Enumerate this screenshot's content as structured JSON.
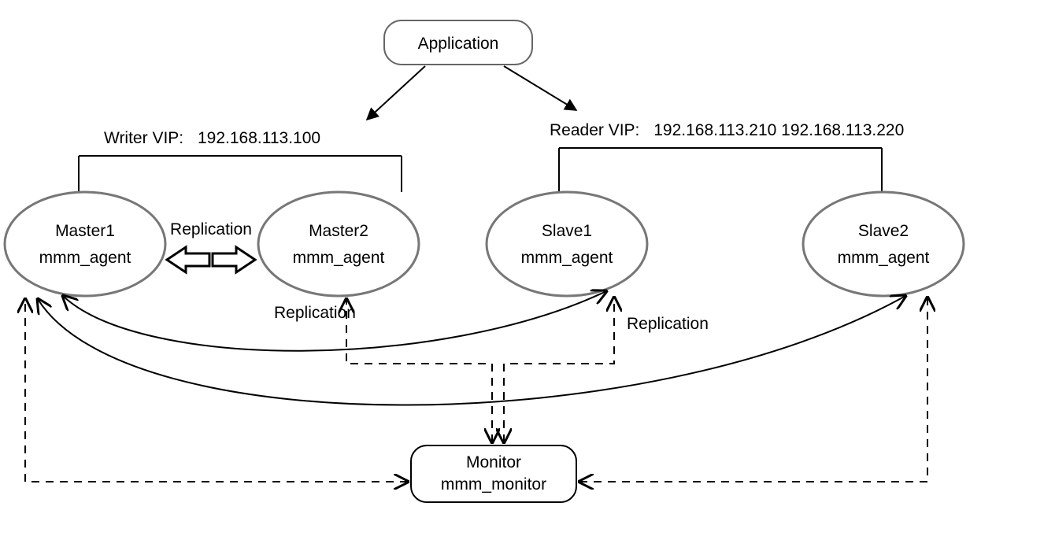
{
  "nodes": {
    "application": {
      "label": "Application"
    },
    "master1": {
      "title": "Master1",
      "subtitle": "mmm_agent"
    },
    "master2": {
      "title": "Master2",
      "subtitle": "mmm_agent"
    },
    "slave1": {
      "title": "Slave1",
      "subtitle": "mmm_agent"
    },
    "slave2": {
      "title": "Slave2",
      "subtitle": "mmm_agent"
    },
    "monitor": {
      "title": "Monitor",
      "subtitle": "mmm_monitor"
    }
  },
  "vips": {
    "writer_label": "Writer VIP:",
    "writer_ips": "192.168.113.100",
    "reader_label": "Reader VIP:",
    "reader_ips": "192.168.113.210  192.168.113.220"
  },
  "edge_labels": {
    "replication_masters": "Replication",
    "replication_mid": "Replication",
    "replication_right": "Replication"
  }
}
